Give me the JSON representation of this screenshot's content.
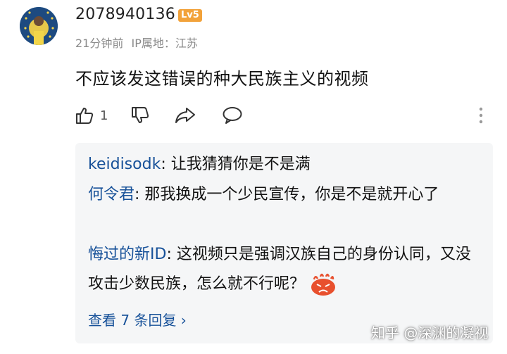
{
  "comment": {
    "username": "2078940136",
    "level_badge": "Lv5",
    "time": "21分钟前",
    "ip_location": "IP属地：江苏",
    "text": "不应该发这错误的种大民族主义的视频",
    "like_count": "1"
  },
  "replies": [
    {
      "author": "keidisodk",
      "text": ": 让我猜猜你是不是满"
    },
    {
      "author": "何令君",
      "text": ": 那我换成一个少民宣传，你是不是就开心了"
    },
    {
      "author": "悔过的新ID",
      "text": ": 这视频只是强调汉族自己的身份认同，又没攻击少数民族，怎么就不行呢？"
    }
  ],
  "view_replies": "查看 7 条回复 ›",
  "watermark": "知乎 @深渊的凝视",
  "colors": {
    "link": "#175199",
    "badge": "#f2a23a",
    "meta": "#8a8a8a",
    "reply_bg": "#f5f6f7"
  }
}
